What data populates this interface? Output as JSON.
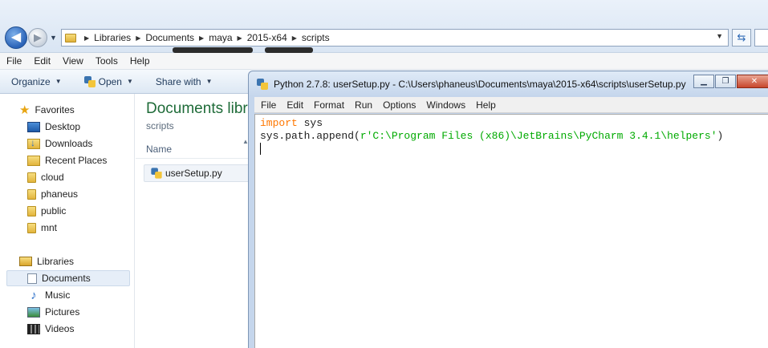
{
  "explorer": {
    "breadcrumbs": [
      "Libraries",
      "Documents",
      "maya",
      "2015-x64",
      "scripts"
    ],
    "menu": [
      "File",
      "Edit",
      "View",
      "Tools",
      "Help"
    ],
    "commands": {
      "organize": "Organize",
      "open": "Open",
      "share": "Share with"
    },
    "nav": {
      "favorites_header": "Favorites",
      "favorites": [
        "Desktop",
        "Downloads",
        "Recent Places",
        "cloud",
        "phaneus",
        "public",
        "mnt"
      ],
      "libraries_header": "Libraries",
      "libraries": [
        "Documents",
        "Music",
        "Pictures",
        "Videos"
      ],
      "selected": "Documents"
    },
    "content": {
      "title": "Documents libr",
      "subtitle": "scripts",
      "column_name": "Name",
      "files": [
        "userSetup.py"
      ]
    }
  },
  "idle": {
    "title": "Python 2.7.8: userSetup.py - C:\\Users\\phaneus\\Documents\\maya\\2015-x64\\scripts\\userSetup.py",
    "menu": [
      "File",
      "Edit",
      "Format",
      "Run",
      "Options",
      "Windows",
      "Help"
    ],
    "code": {
      "line1_kw": "import",
      "line1_rest": " sys",
      "line2_pre": "sys.path.append(",
      "line2_str": "r'C:\\Program Files (x86)\\JetBrains\\PyCharm 3.4.1\\helpers'",
      "line2_post": ")"
    }
  },
  "colors": {
    "keyword": "#ff7700",
    "string": "#00aa00",
    "library_title": "#1e6b38"
  }
}
